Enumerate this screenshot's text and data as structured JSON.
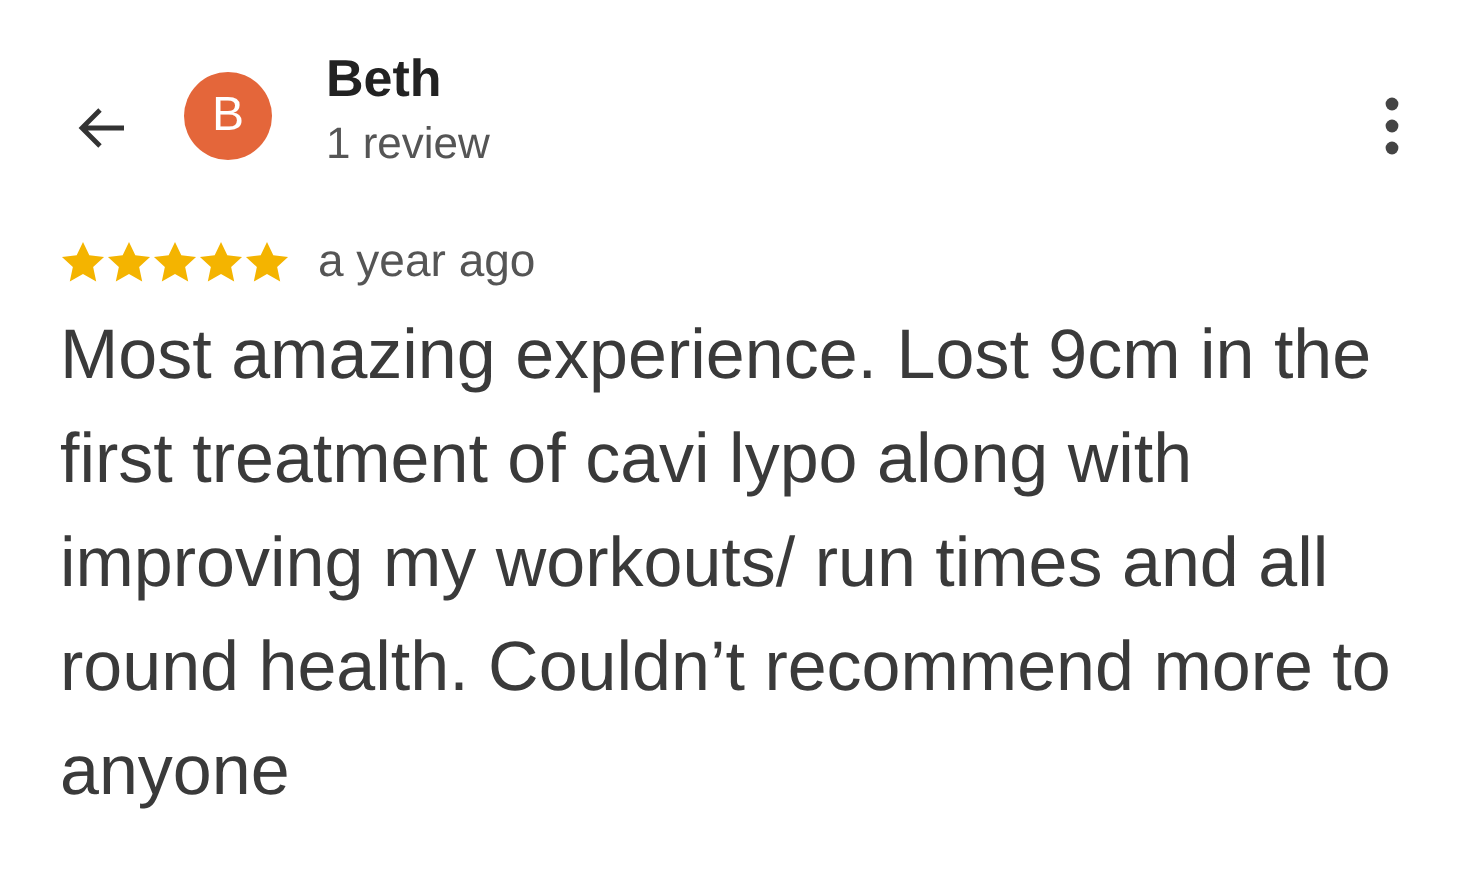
{
  "reviewer": {
    "initial": "B",
    "name": "Beth",
    "review_count": "1 review"
  },
  "review": {
    "stars": 5,
    "time": "a year ago",
    "text": "Most amazing experience. Lost 9cm in the first treatment of cavi lypo along with improving my workouts/ run times and all round health. Couldn’t recommend more to anyone"
  }
}
